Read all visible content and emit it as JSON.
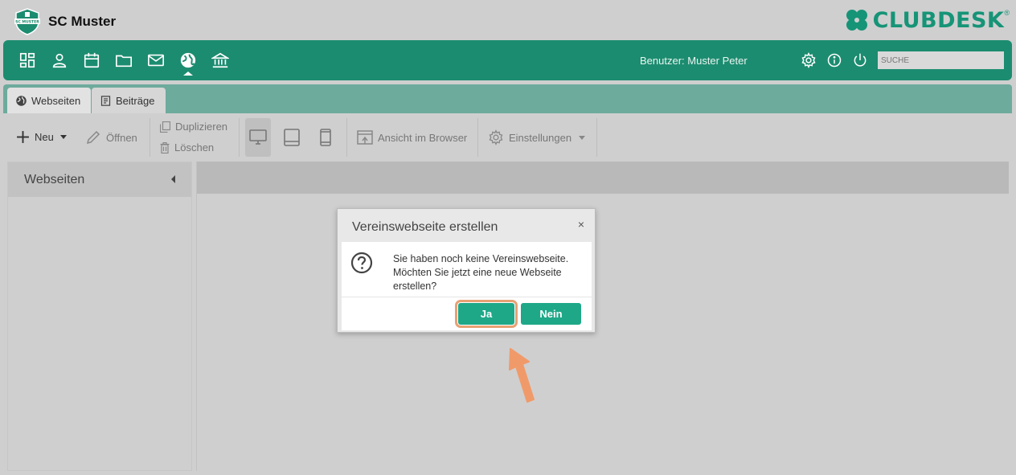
{
  "header": {
    "club_name": "SC Muster",
    "club_logo_text": "SC MUSTER",
    "brand": "CLUBDESK",
    "brand_reg": "®"
  },
  "mainnav": {
    "items": [
      "dashboard-icon",
      "person-icon",
      "calendar-icon",
      "folder-icon",
      "mail-icon",
      "globe-icon",
      "bank-icon"
    ],
    "user_label": "Benutzer: Muster Peter",
    "search_placeholder": "SUCHE"
  },
  "tabs": [
    {
      "label": "Webseiten",
      "icon": "globe-icon",
      "active": true
    },
    {
      "label": "Beiträge",
      "icon": "document-icon",
      "active": false
    }
  ],
  "toolbar": {
    "new_label": "Neu",
    "open_label": "Öffnen",
    "duplicate_label": "Duplizieren",
    "delete_label": "Löschen",
    "browser_label": "Ansicht im Browser",
    "settings_label": "Einstellungen"
  },
  "left_panel": {
    "title": "Webseiten"
  },
  "dialog": {
    "title": "Vereinswebseite erstellen",
    "close": "×",
    "lines": [
      "Sie haben noch keine Vereinswebseite.",
      "Möchten Sie jetzt eine neue Webseite",
      "erstellen?"
    ],
    "yes_label": "Ja",
    "no_label": "Nein"
  },
  "colors": {
    "brand_green": "#1c8c70",
    "button_green": "#1ea888",
    "highlight": "#e8a173"
  }
}
